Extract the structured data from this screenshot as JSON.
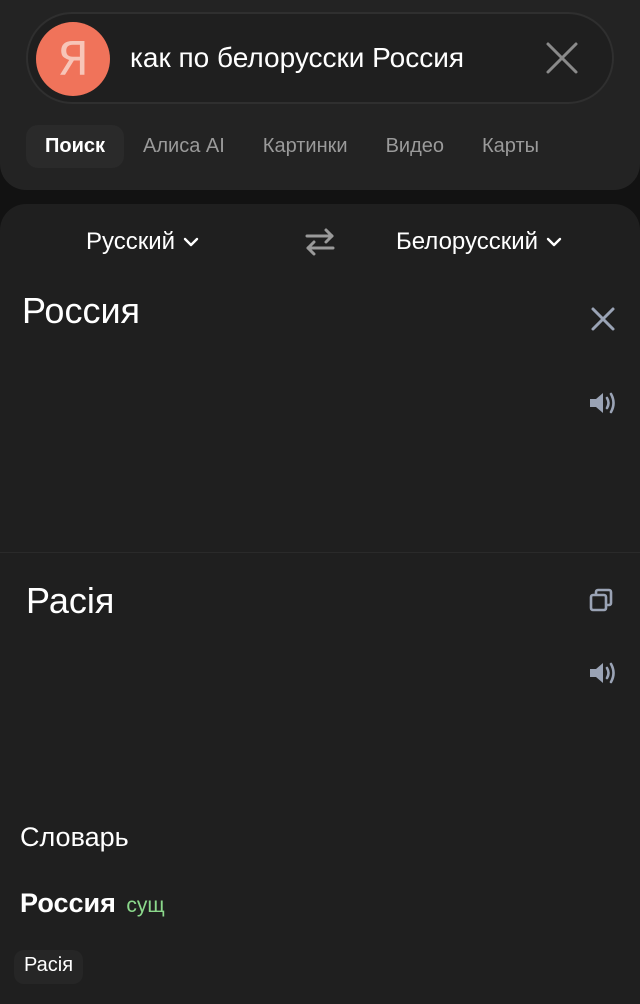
{
  "search": {
    "logo_letter": "Я",
    "query": "как по белорусски Россия"
  },
  "tabs": [
    {
      "label": "Поиск",
      "active": true
    },
    {
      "label": "Алиса AI",
      "active": false
    },
    {
      "label": "Картинки",
      "active": false
    },
    {
      "label": "Видео",
      "active": false
    },
    {
      "label": "Карты",
      "active": false
    }
  ],
  "translator": {
    "source_lang": "Русский",
    "target_lang": "Белорусский",
    "source_text": "Россия",
    "target_text": "Расія"
  },
  "dictionary": {
    "title": "Словарь",
    "word": "Россия",
    "part_of_speech": "сущ",
    "translation": "Расія"
  },
  "icons": {
    "clear": "close-icon",
    "swap": "swap-icon",
    "speaker": "speaker-icon",
    "copy": "copy-icon",
    "chevron": "chevron-down-icon"
  },
  "colors": {
    "logo": "#f0735a",
    "part_of_speech": "#8bd88b",
    "background": "#121212"
  }
}
